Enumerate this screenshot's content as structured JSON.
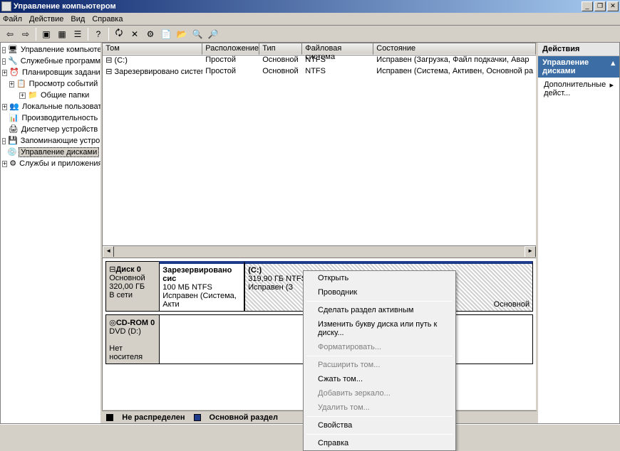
{
  "window": {
    "title": "Управление компьютером"
  },
  "menubar": [
    "Файл",
    "Действие",
    "Вид",
    "Справка"
  ],
  "tree": {
    "root": "Управление компьютером (лока",
    "svc": "Служебные программы",
    "svc_items": [
      "Планировщик заданий",
      "Просмотр событий",
      "Общие папки",
      "Локальные пользовател",
      "Производительность",
      "Диспетчер устройств"
    ],
    "storage": "Запоминающие устройства",
    "storage_item": "Управление дисками",
    "apps": "Службы и приложения"
  },
  "vol_headers": [
    "Том",
    "Расположение",
    "Тип",
    "Файловая система",
    "Состояние"
  ],
  "volumes": [
    {
      "name": "(C:)",
      "layout": "Простой",
      "type": "Основной",
      "fs": "NTFS",
      "status": "Исправен (Загрузка, Файл подкачки, Авар"
    },
    {
      "name": "Зарезервировано системой",
      "layout": "Простой",
      "type": "Основной",
      "fs": "NTFS",
      "status": "Исправен (Система, Активен, Основной ра"
    }
  ],
  "disks": {
    "d0_name": "Диск 0",
    "d0_type": "Основной",
    "d0_size": "320,00 ГБ",
    "d0_status": "В сети",
    "d0_p0_name": "Зарезервировано сис",
    "d0_p0_info": "100 МБ NTFS",
    "d0_p0_status": "Исправен (Система, Акти",
    "d0_p1_name": "(C:)",
    "d0_p1_info": "319,90 ГБ NTFS",
    "d0_p1_status": "Исправен (З",
    "d0_p1_extra": "Основной",
    "cd_name": "CD-ROM 0",
    "cd_dev": "DVD (D:)",
    "cd_status": "Нет носителя"
  },
  "legend": {
    "unalloc": "Не распределен",
    "primary": "Основной раздел"
  },
  "actions": {
    "header": "Действия",
    "sub": "Управление дисками",
    "more": "Дополнительные дейст..."
  },
  "context": {
    "open": "Открыть",
    "explorer": "Проводник",
    "active": "Сделать раздел активным",
    "letter": "Изменить букву диска или путь к диску...",
    "format": "Форматировать...",
    "extend": "Расширить том...",
    "shrink": "Сжать том...",
    "mirror": "Добавить зеркало...",
    "delete": "Удалить том...",
    "props": "Свойства",
    "help": "Справка"
  }
}
